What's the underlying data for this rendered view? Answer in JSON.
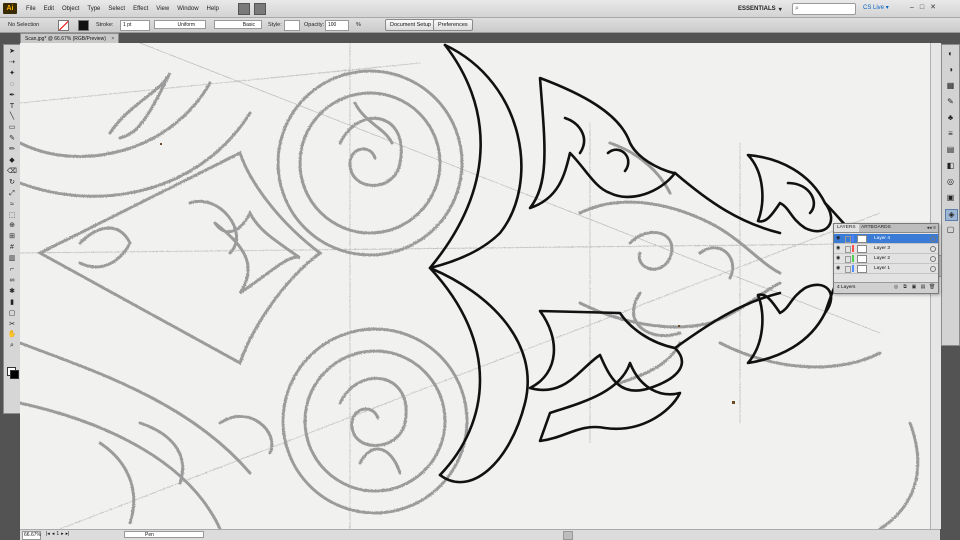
{
  "app": {
    "logo": "Ai"
  },
  "menu": [
    "File",
    "Edit",
    "Object",
    "Type",
    "Select",
    "Effect",
    "View",
    "Window",
    "Help"
  ],
  "workspace": {
    "label": "ESSENTIALS",
    "caret": "▾"
  },
  "live": {
    "label": "CS Live",
    "caret": "▾"
  },
  "window_controls": [
    "–",
    "□",
    "✕"
  ],
  "control_bar": {
    "selection_label": "No Selection",
    "stroke_label": "Stroke:",
    "stroke_weight": "1 pt",
    "stroke_profile": "Uniform",
    "brush": "Basic",
    "style_label": "Style:",
    "opacity_label": "Opacity:",
    "opacity_value": "100",
    "opacity_unit": "%",
    "document_setup": "Document Setup",
    "preferences": "Preferences"
  },
  "document_tab": {
    "title": "Scan.jpg* @ 66.67% (RGB/Preview)",
    "close": "×"
  },
  "status_bar": {
    "zoom": "66.67%",
    "nav": [
      "|◂",
      "◂",
      "1",
      "▸",
      "▸|"
    ],
    "status": "Pen"
  },
  "layers_panel": {
    "tabs": [
      "LAYERS",
      "ARTBOARDS"
    ],
    "controls": "◂◂ ≡",
    "layers": [
      {
        "name": "Layer 4",
        "color": "#4f7fff",
        "selected": true
      },
      {
        "name": "Layer 3",
        "color": "#ff4f4f",
        "selected": false
      },
      {
        "name": "Layer 2",
        "color": "#4fcf4f",
        "selected": false
      },
      {
        "name": "Layer 1",
        "color": "#4f8fff",
        "selected": false
      }
    ],
    "footer_count": "4 Layers",
    "footer_buttons": [
      "◎",
      "⧉",
      "▣",
      "▤",
      "🗑"
    ]
  },
  "tools": [
    "selection",
    "direct-selection",
    "magic-wand",
    "lasso",
    "pen",
    "type",
    "line",
    "rectangle",
    "paintbrush",
    "pencil",
    "blob-brush",
    "eraser",
    "rotate",
    "scale",
    "width",
    "free-transform",
    "shape-builder",
    "perspective",
    "mesh",
    "gradient",
    "eyedropper",
    "blend",
    "symbol-sprayer",
    "column-graph",
    "artboard",
    "slice",
    "hand",
    "zoom"
  ],
  "tool_glyphs": [
    "➤",
    "⇢",
    "✦",
    "◌",
    "✒",
    "T",
    "╲",
    "▭",
    "✎",
    "✏",
    "◆",
    "⌫",
    "↻",
    "⤢",
    "≈",
    "⬚",
    "⊕",
    "⊞",
    "#",
    "▥",
    "⌐",
    "∞",
    "✱",
    "▮",
    "▢",
    "✂",
    "✋",
    "⌕"
  ],
  "dock_icons": [
    "color-icon",
    "color-guide-icon",
    "swatches-icon",
    "brushes-icon",
    "symbols-icon",
    "stroke-icon",
    "gradient-icon",
    "transparency-icon",
    "appearance-icon",
    "graphic-styles-icon",
    "layers-icon",
    "artboards-icon"
  ],
  "dock_glyphs": [
    "◐",
    "◑",
    "▦",
    "✎",
    "♣",
    "≡",
    "▤",
    "◧",
    "◎",
    "▣",
    "◈",
    "▢"
  ]
}
